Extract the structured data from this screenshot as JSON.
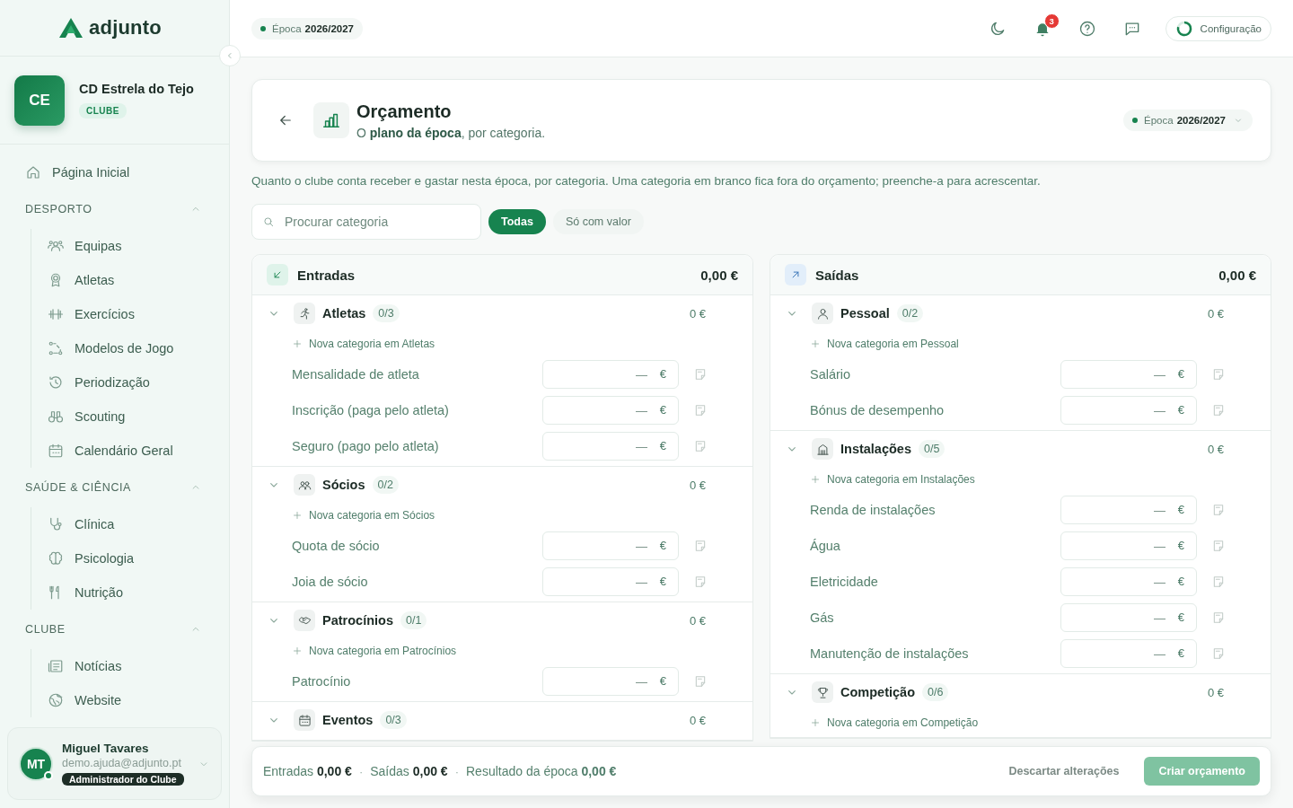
{
  "sidebar": {
    "logo": "adjunto",
    "club": {
      "initials": "CE",
      "name": "CD Estrela do Tejo",
      "badge": "CLUBE"
    },
    "home": {
      "label": "Página Inicial"
    },
    "sections": [
      {
        "title": "DESPORTO",
        "expanded": true,
        "items": [
          {
            "label": "Equipas"
          },
          {
            "label": "Atletas"
          },
          {
            "label": "Exercícios"
          },
          {
            "label": "Modelos de Jogo"
          },
          {
            "label": "Periodização"
          },
          {
            "label": "Scouting"
          },
          {
            "label": "Calendário Geral"
          }
        ]
      },
      {
        "title": "SAÚDE & CIÊNCIA",
        "expanded": true,
        "items": [
          {
            "label": "Clínica"
          },
          {
            "label": "Psicologia"
          },
          {
            "label": "Nutrição"
          }
        ]
      },
      {
        "title": "CLUBE",
        "expanded": true,
        "items": [
          {
            "label": "Notícias"
          },
          {
            "label": "Website"
          }
        ]
      }
    ],
    "user": {
      "initials": "MT",
      "name": "Miguel Tavares",
      "email": "demo.ajuda@adjunto.pt",
      "role": "Administrador do Clube",
      "online": true
    }
  },
  "topbar": {
    "season": {
      "label": "Época",
      "value": "2026/2027"
    },
    "notifications": "3",
    "config": "Configuração"
  },
  "header": {
    "title": "Orçamento",
    "subtitle": "O **plano da época**, por categoria.",
    "season": {
      "label": "Época",
      "value": "2026/2027"
    }
  },
  "description": "Quanto o clube conta receber e gastar nesta época, por categoria. Uma categoria em branco fica fora do orçamento; preenche-a para acrescentar.",
  "search": {
    "placeholder": "Procurar categoria"
  },
  "filters": [
    {
      "label": "Todas",
      "selected": true
    },
    {
      "label": "Só com valor",
      "selected": false
    }
  ],
  "columns": [
    {
      "kind": "income",
      "title": "Entradas",
      "total": "0,00 €",
      "groups": [
        {
          "name": "Atletas",
          "count": "0/3",
          "total": "0 €",
          "expanded": true,
          "add": "Nova categoria em Atletas",
          "items": [
            {
              "label": "Mensalidade de atleta",
              "placeholder": "—",
              "unit": "€"
            },
            {
              "label": "Inscrição (paga pelo atleta)",
              "placeholder": "—",
              "unit": "€"
            },
            {
              "label": "Seguro (pago pelo atleta)",
              "placeholder": "—",
              "unit": "€"
            }
          ]
        },
        {
          "name": "Sócios",
          "count": "0/2",
          "total": "0 €",
          "expanded": true,
          "add": "Nova categoria em Sócios",
          "items": [
            {
              "label": "Quota de sócio",
              "placeholder": "—",
              "unit": "€"
            },
            {
              "label": "Joia de sócio",
              "placeholder": "—",
              "unit": "€"
            }
          ]
        },
        {
          "name": "Patrocínios",
          "count": "0/1",
          "total": "0 €",
          "expanded": true,
          "add": "Nova categoria em Patrocínios",
          "items": [
            {
              "label": "Patrocínio",
              "placeholder": "—",
              "unit": "€"
            }
          ]
        },
        {
          "name": "Eventos",
          "count": "0/3",
          "total": "0 €",
          "expanded": true
        }
      ]
    },
    {
      "kind": "expense",
      "title": "Saídas",
      "total": "0,00 €",
      "groups": [
        {
          "name": "Pessoal",
          "count": "0/2",
          "total": "0 €",
          "expanded": true,
          "add": "Nova categoria em Pessoal",
          "items": [
            {
              "label": "Salário",
              "placeholder": "—",
              "unit": "€"
            },
            {
              "label": "Bónus de desempenho",
              "placeholder": "—",
              "unit": "€"
            }
          ]
        },
        {
          "name": "Instalações",
          "count": "0/5",
          "total": "0 €",
          "expanded": true,
          "add": "Nova categoria em Instalações",
          "items": [
            {
              "label": "Renda de instalações",
              "placeholder": "—",
              "unit": "€"
            },
            {
              "label": "Água",
              "placeholder": "—",
              "unit": "€"
            },
            {
              "label": "Eletricidade",
              "placeholder": "—",
              "unit": "€"
            },
            {
              "label": "Gás",
              "placeholder": "—",
              "unit": "€"
            },
            {
              "label": "Manutenção de instalações",
              "placeholder": "—",
              "unit": "€"
            }
          ]
        },
        {
          "name": "Competição",
          "count": "0/6",
          "total": "0 €",
          "expanded": true,
          "add": "Nova categoria em Competição"
        }
      ]
    }
  ],
  "footer": {
    "summary": [
      {
        "label": "Entradas",
        "value": "0,00 €",
        "kind": "plain"
      },
      {
        "label": "Saídas",
        "value": "0,00 €",
        "kind": "plain"
      },
      {
        "label": "Resultado da época",
        "value": "0,00 €",
        "kind": "result"
      }
    ],
    "separator": "·",
    "discard": "Descartar alterações",
    "create": {
      "label": "Criar orçamento",
      "disabled": true
    }
  }
}
